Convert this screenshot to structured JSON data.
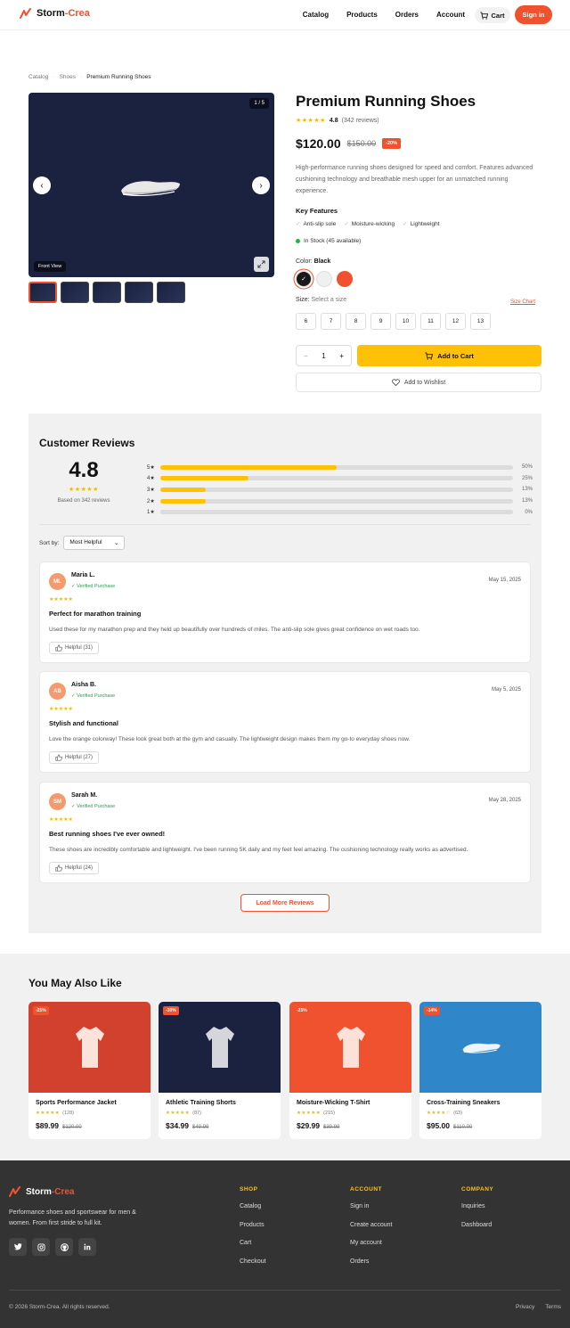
{
  "header": {
    "logo_part1": "Storm",
    "logo_part2": "-Crea",
    "nav": [
      "Catalog",
      "Products",
      "Orders",
      "Account"
    ],
    "cart_label": "Cart",
    "signin_label": "Sign in",
    "accent": "#f0512e"
  },
  "breadcrumb": [
    "Catalog",
    "Shoes",
    "Premium Running Shoes"
  ],
  "gallery": {
    "counter": "1 / 5",
    "front_label": "Front View",
    "prev_icon": "‹",
    "next_icon": "›",
    "thumbnail_count": 5
  },
  "product": {
    "title": "Premium Running Shoes",
    "stars": "★★★★★",
    "rating": "4.8",
    "review_count": "(342 reviews)",
    "price": "$120.00",
    "old_price": "$150.00",
    "discount": "-20%",
    "description": "High-performance running shoes designed for speed and comfort. Features advanced cushioning technology and breathable mesh upper for an unmatched running experience.",
    "features_title": "Key Features",
    "features": [
      "Anti-slip sole",
      "Moisture-wicking",
      "Lightweight"
    ],
    "feature_check": "✓",
    "stock": "In Stock (45 available)",
    "color_label": "Color:",
    "color_value": "Black",
    "colors": [
      "#1a1a1a",
      "#f0f0f0",
      "#f0512e"
    ],
    "selected_mark": "✓",
    "size_label": "Size:",
    "size_hint": "Select a size",
    "size_chart": "Size Chart",
    "sizes": [
      "6",
      "7",
      "8",
      "9",
      "10",
      "11",
      "12",
      "13"
    ],
    "qty_minus": "−",
    "quantity": "1",
    "qty_plus": "+",
    "add_to_cart": "Add to Cart",
    "wishlist": "Add to Wishlist"
  },
  "reviews": {
    "title": "Customer Reviews",
    "average": "4.8",
    "stars": "★★★★★",
    "based_on": "Based on 342 reviews",
    "distribution": [
      {
        "label": "5★",
        "fraction": 0.5,
        "pct": "50%"
      },
      {
        "label": "4★",
        "fraction": 0.25,
        "pct": "25%"
      },
      {
        "label": "3★",
        "fraction": 0.13,
        "pct": "13%"
      },
      {
        "label": "2★",
        "fraction": 0.13,
        "pct": "13%"
      },
      {
        "label": "1★",
        "fraction": 0.0,
        "pct": "0%"
      }
    ],
    "sort_label": "Sort by:",
    "sort_value": "Most Helpful",
    "items": [
      {
        "initials": "ML",
        "name": "Maria L.",
        "verified": "✓ Verified Purchase",
        "date": "May 15, 2025",
        "stars": "★★★★★",
        "title": "Perfect for marathon training",
        "body": "Used these for my marathon prep and they held up beautifully over hundreds of miles. The anti-slip sole gives great confidence on wet roads too.",
        "helpful": "Helpful (31)"
      },
      {
        "initials": "AB",
        "name": "Aisha B.",
        "verified": "✓ Verified Purchase",
        "date": "May 5, 2025",
        "stars": "★★★★★",
        "title": "Stylish and functional",
        "body": "Love the orange colorway! These look great both at the gym and casually. The lightweight design makes them my go-to everyday shoes now.",
        "helpful": "Helpful (27)"
      },
      {
        "initials": "SM",
        "name": "Sarah M.",
        "verified": "✓ Verified Purchase",
        "date": "May 28, 2025",
        "stars": "★★★★★",
        "title": "Best running shoes I've ever owned!",
        "body": "These shoes are incredibly comfortable and lightweight. I've been running 5K daily and my feet feel amazing. The cushioning technology really works as advertised.",
        "helpful": "Helpful (24)"
      }
    ],
    "load_more": "Load More Reviews"
  },
  "recommendations": {
    "title": "You May Also Like",
    "items": [
      {
        "badge": "-25%",
        "name": "Sports Performance Jacket",
        "stars": "★★★★★",
        "count": "(128)",
        "price": "$89.99",
        "old": "$120.00",
        "bg": "#d2402e",
        "kind": "shirt"
      },
      {
        "badge": "-30%",
        "name": "Athletic Training Shorts",
        "stars": "★★★★★",
        "count": "(87)",
        "price": "$34.99",
        "old": "$49.99",
        "bg": "#1a2240",
        "kind": "shirt"
      },
      {
        "badge": "-25%",
        "name": "Moisture-Wicking T-Shirt",
        "stars": "★★★★★",
        "count": "(215)",
        "price": "$29.99",
        "old": "$39.99",
        "bg": "#f0512e",
        "kind": "shirt"
      },
      {
        "badge": "-14%",
        "name": "Cross-Training Sneakers",
        "stars": "★★★★☆",
        "count": "(63)",
        "price": "$95.00",
        "old": "$110.00",
        "bg": "#2f86c8",
        "kind": "shoe"
      }
    ]
  },
  "footer": {
    "logo_part1": "Storm",
    "logo_part2": "-Crea",
    "tagline": "Performance shoes and sportswear for men & women. From first stride to full kit.",
    "columns": [
      {
        "heading": "SHOP",
        "links": [
          "Catalog",
          "Products",
          "Cart",
          "Checkout"
        ]
      },
      {
        "heading": "ACCOUNT",
        "links": [
          "Sign in",
          "Create account",
          "My account",
          "Orders"
        ]
      },
      {
        "heading": "COMPANY",
        "links": [
          "Inquiries",
          "Dashboard"
        ]
      }
    ],
    "copyright": "© 2026 Storm-Crea. All rights reserved.",
    "legal": [
      "Privacy",
      "Terms"
    ]
  }
}
